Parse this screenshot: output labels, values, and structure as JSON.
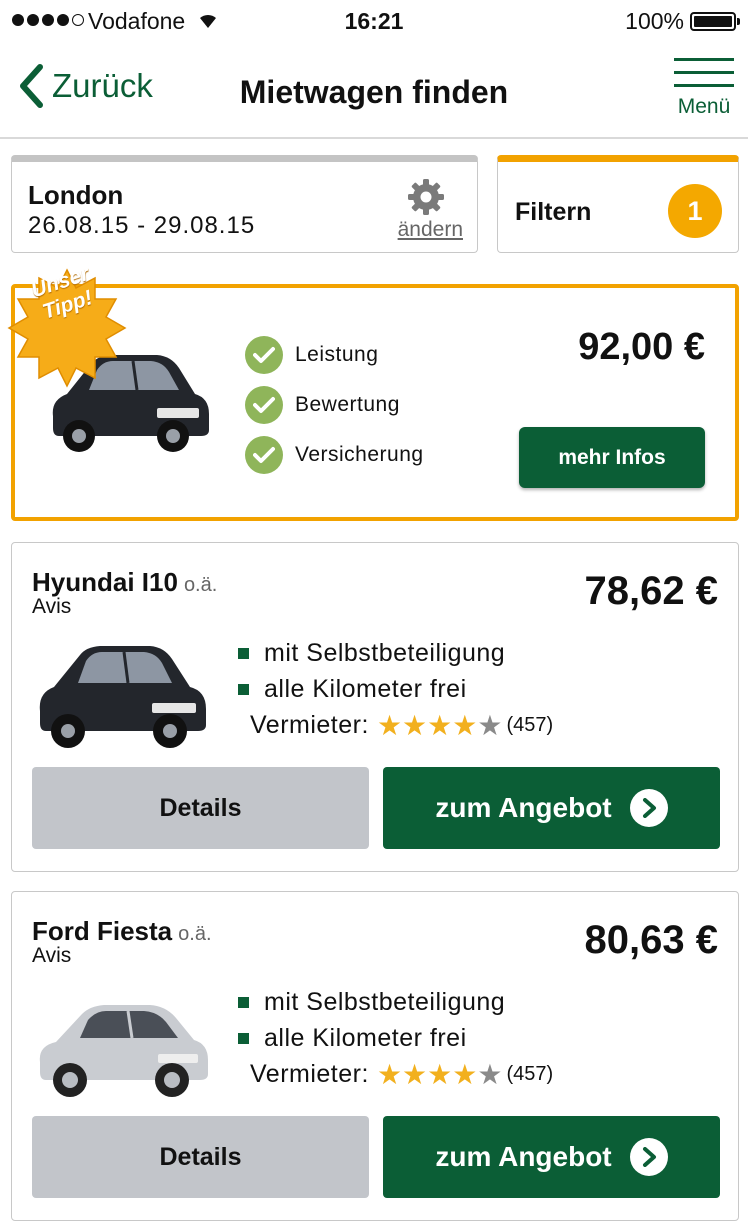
{
  "status_bar": {
    "carrier": "Vodafone",
    "time": "16:21",
    "battery": "100%"
  },
  "nav": {
    "back_label": "Zurück",
    "title": "Mietwagen finden",
    "menu_label": "Menü"
  },
  "search": {
    "city": "London",
    "dates": "26.08.15 - 29.08.15",
    "change_label": "ändern"
  },
  "filter": {
    "label": "Filtern",
    "count": "1"
  },
  "tip": {
    "badge_line1": "Unser",
    "badge_line2": "Tipp!",
    "checks": [
      "Leistung",
      "Bewertung",
      "Versicherung"
    ],
    "price": "92,00 €",
    "button_label": "mehr Infos"
  },
  "offers": [
    {
      "name": "Hyundai I10",
      "suffix": "o.ä.",
      "vendor": "Avis",
      "price": "78,62 €",
      "features": [
        "mit Selbstbeteiligung",
        "alle Kilometer frei"
      ],
      "rating_label": "Vermieter:",
      "rating": 4,
      "rating_max": 5,
      "reviews": "(457)",
      "details_label": "Details",
      "offer_label": "zum Angebot",
      "car_color": "dark"
    },
    {
      "name": "Ford Fiesta",
      "suffix": "o.ä.",
      "vendor": "Avis",
      "price": "80,63 €",
      "features": [
        "mit Selbstbeteiligung",
        "alle Kilometer frei"
      ],
      "rating_label": "Vermieter:",
      "rating": 4,
      "rating_max": 5,
      "reviews": "(457)",
      "details_label": "Details",
      "offer_label": "zum Angebot",
      "car_color": "silver"
    }
  ],
  "colors": {
    "brand_green": "#0b5e36",
    "accent_orange": "#f2a200",
    "check_green": "#8fb55a",
    "star_gold": "#f2b01e"
  }
}
